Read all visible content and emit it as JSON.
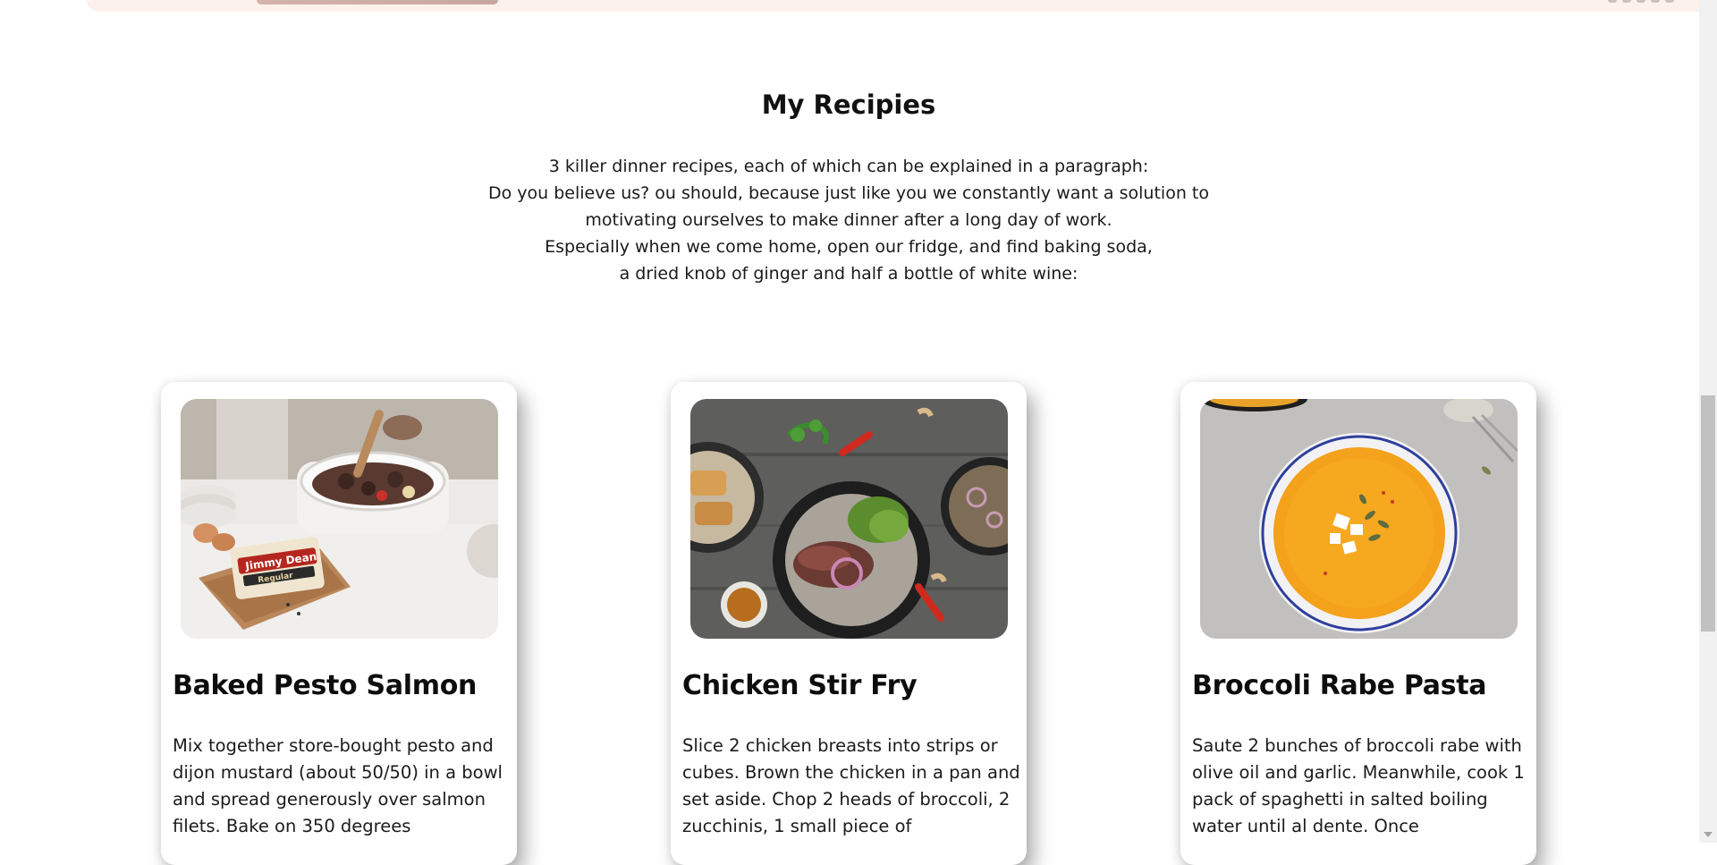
{
  "section": {
    "title": "My Recipies",
    "intro_lines": [
      "3 killer dinner recipes, each of which can be explained in a paragraph:",
      "Do you believe us? ou should, because just like you we constantly want a solution to",
      "motivating ourselves to make dinner after a long day of work.",
      "Especially when we come home, open our fridge, and find baking soda,",
      "a dried knob of ginger and half a bottle of white wine:"
    ]
  },
  "cards": [
    {
      "title": "Baked Pesto Salmon",
      "text": "Mix together store-bought pesto and dijon mustard (about 50/50) in a bowl and spread generously over salmon filets. Bake on 350 degrees",
      "image_label": "Jimmy Dean",
      "image_sublabel": "Regular"
    },
    {
      "title": "Chicken Stir Fry",
      "text": "Slice 2 chicken breasts into strips or cubes. Brown the chicken in a pan and set aside. Chop 2 heads of broccoli, 2 zucchinis, 1 small piece of"
    },
    {
      "title": "Broccoli Rabe Pasta",
      "text": "Saute 2 bunches of broccoli rabe with olive oil and garlic. Meanwhile, cook 1 pack of spaghetti in salted boiling water until al dente. Once"
    }
  ],
  "colors": {
    "top_band": "#fdf1ec",
    "text": "#111111",
    "scrollbar_track": "#f1f1f1",
    "scrollbar_thumb": "#c1c1c1"
  },
  "icons": [
    "chevron-down-icon"
  ]
}
